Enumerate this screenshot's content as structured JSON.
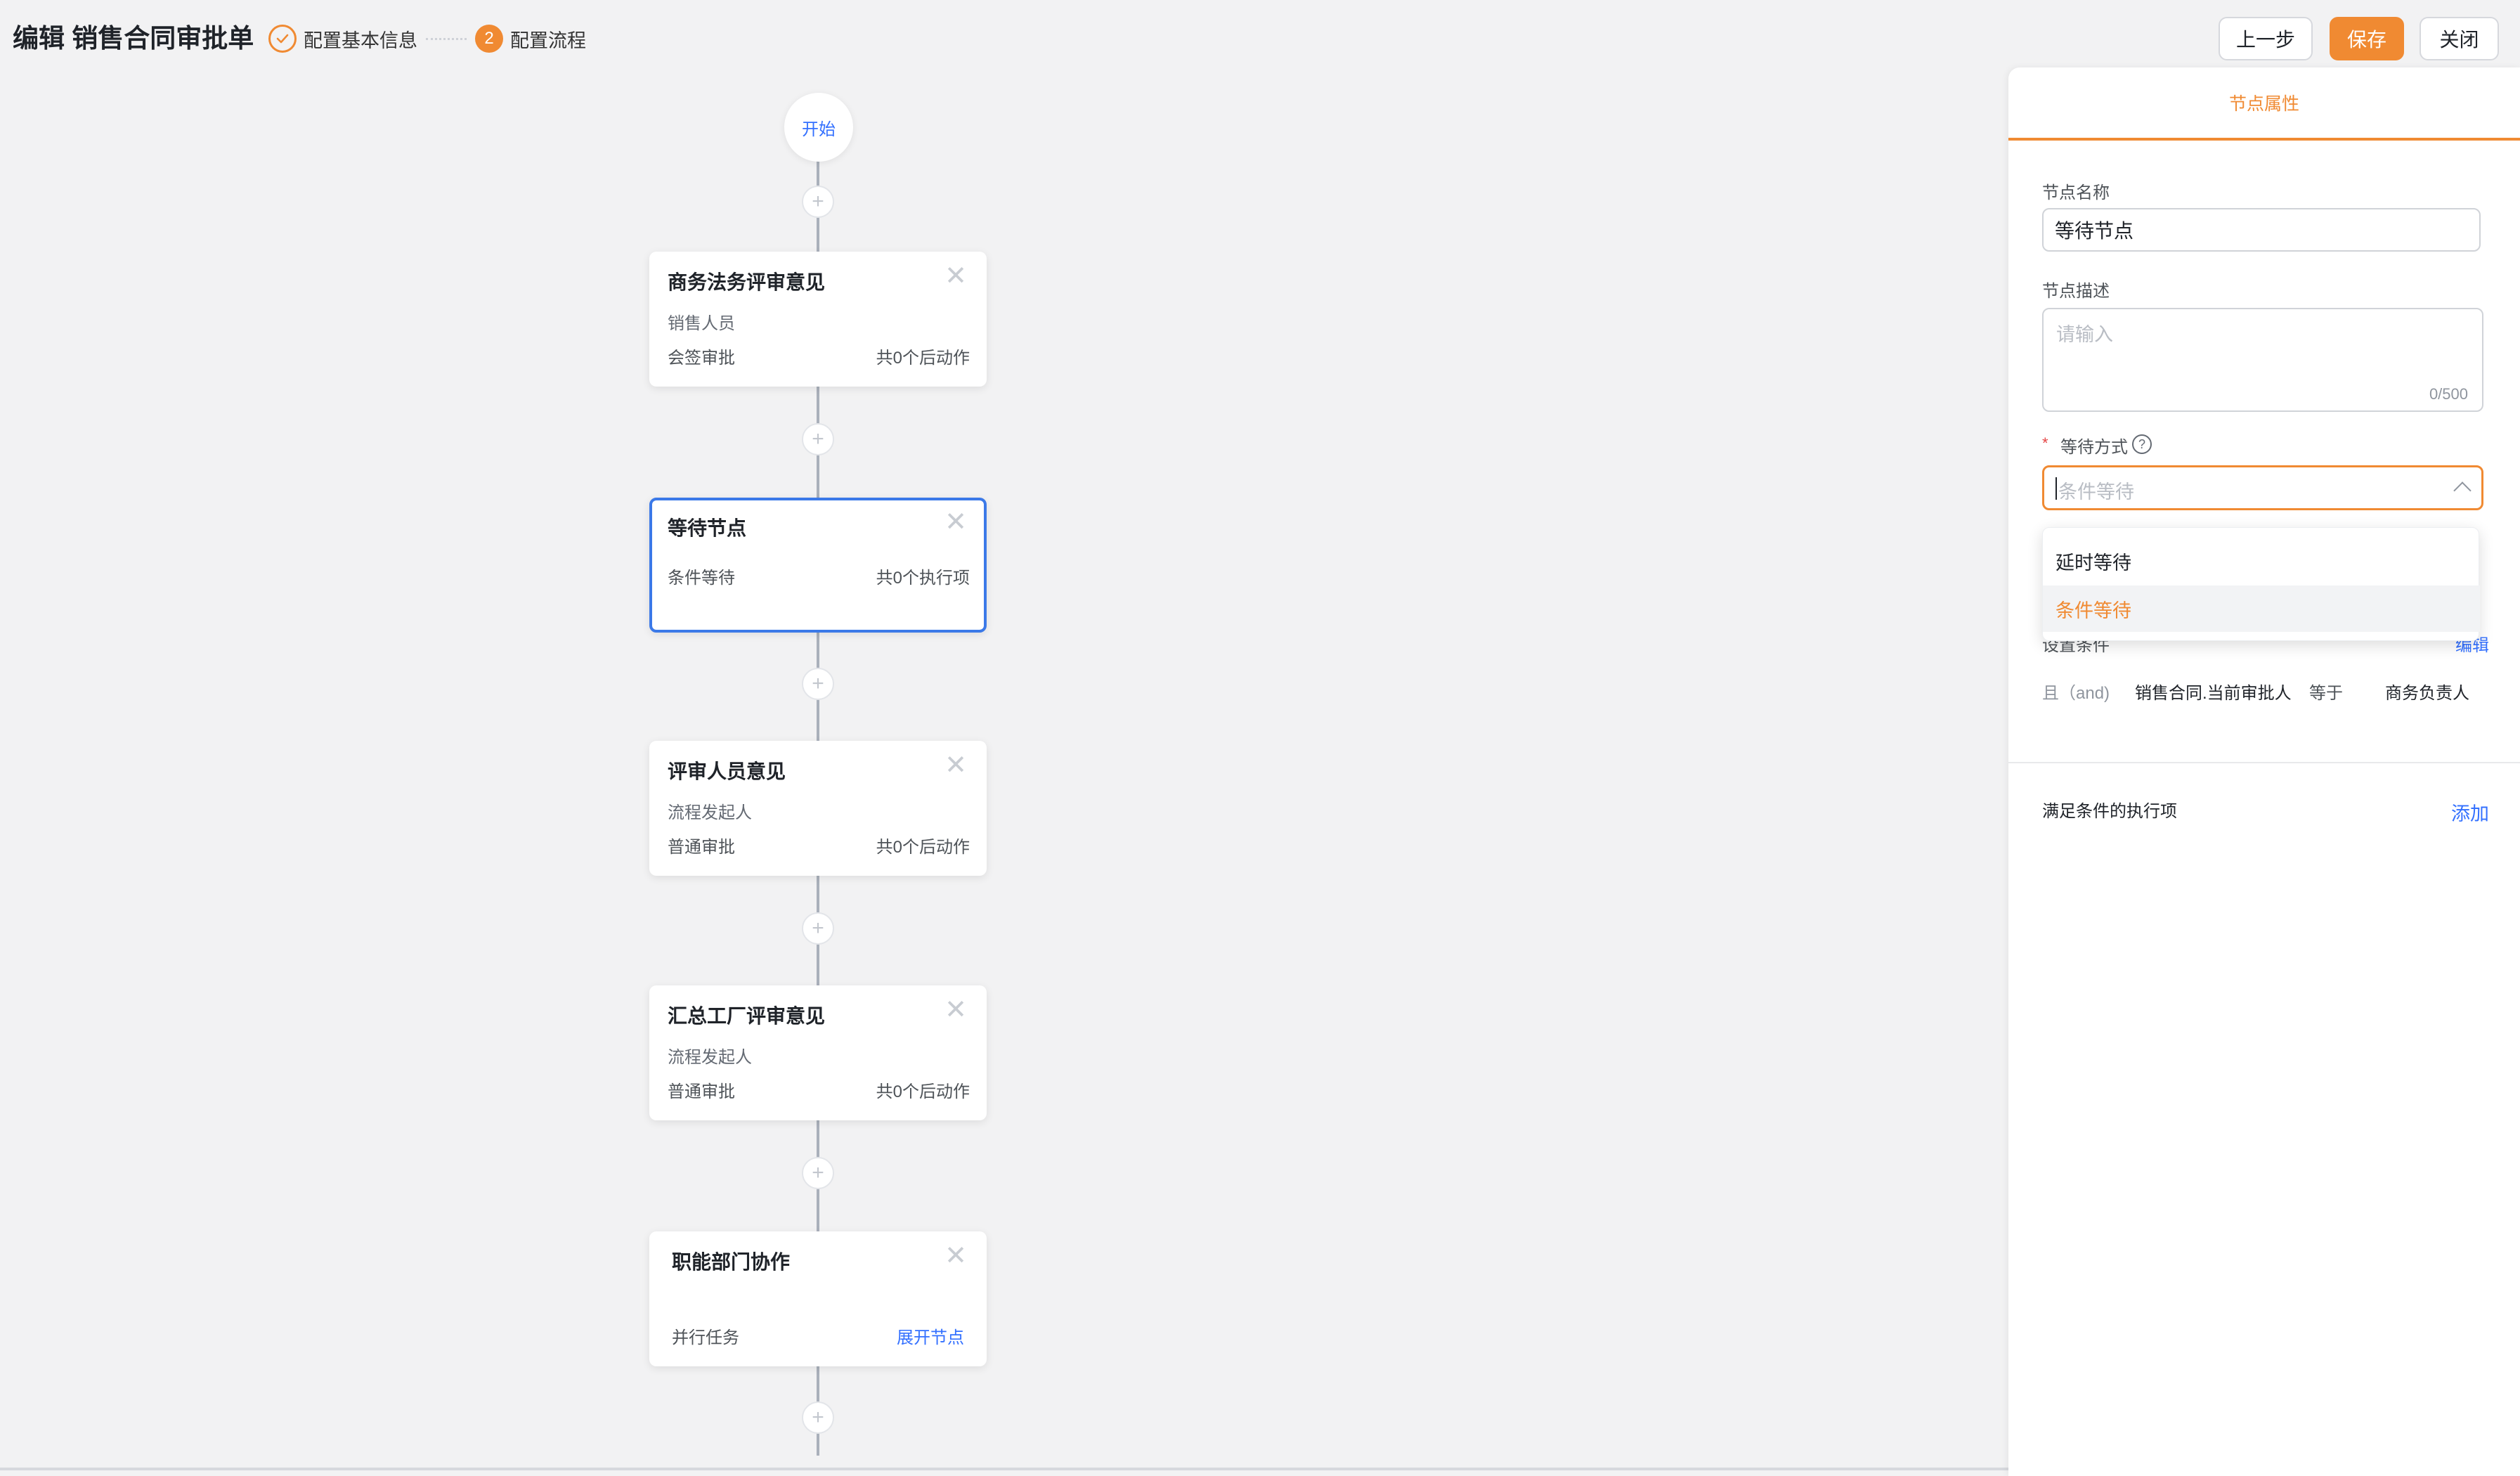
{
  "header": {
    "title": "编辑 销售合同审批单",
    "steps": [
      {
        "number": "",
        "label": "配置基本信息",
        "state": "done"
      },
      {
        "number": "2",
        "label": "配置流程",
        "state": "active"
      }
    ],
    "buttons": {
      "prev": "上一步",
      "save": "保存",
      "close": "关闭"
    }
  },
  "colors": {
    "accent": "#f08a32",
    "link": "#3370ff",
    "selected_border": "#3b79e8"
  },
  "flow": {
    "start_label": "开始",
    "plus_symbol": "+",
    "close_symbol": "✕",
    "nodes": [
      {
        "title": "商务法务评审意见",
        "subtitle": "销售人员",
        "type": "会签审批",
        "meta": "共0个后动作"
      },
      {
        "title": "等待节点",
        "subtitle": "",
        "type": "条件等待",
        "meta": "共0个执行项",
        "selected": true
      },
      {
        "title": "评审人员意见",
        "subtitle": "流程发起人",
        "type": "普通审批",
        "meta": "共0个后动作"
      },
      {
        "title": "汇总工厂评审意见",
        "subtitle": "流程发起人",
        "type": "普通审批",
        "meta": "共0个后动作"
      },
      {
        "title": "职能部门协作",
        "subtitle": "",
        "type": "并行任务",
        "link": "展开节点"
      }
    ]
  },
  "panel": {
    "tab": "节点属性",
    "name_label": "节点名称",
    "name_value": "等待节点",
    "desc_label": "节点描述",
    "desc_placeholder": "请输入",
    "desc_count": "0/500",
    "wait_label": "等待方式",
    "required_mark": "*",
    "help_symbol": "?",
    "wait_placeholder": "条件等待",
    "wait_options": [
      "延时等待",
      "条件等待"
    ],
    "wait_selected": "条件等待",
    "condition_label": "设置条件",
    "condition_edit": "编辑",
    "condition": {
      "conj": "且（and)",
      "field": "销售合同.当前审批人",
      "op": "等于",
      "value": "商务负责人"
    },
    "exec_label": "满足条件的执行项",
    "exec_add": "添加"
  }
}
